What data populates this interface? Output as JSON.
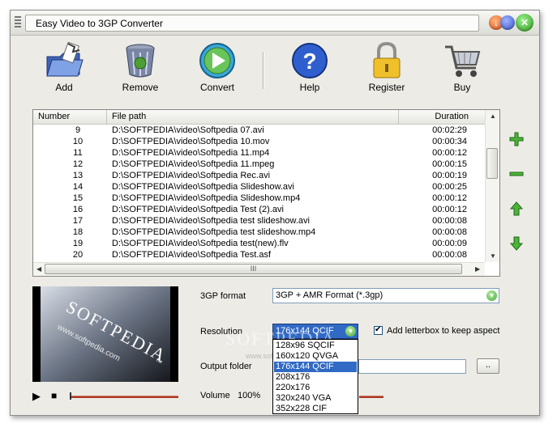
{
  "window": {
    "title": "Easy Video to 3GP Converter"
  },
  "toolbar": {
    "add": "Add",
    "remove": "Remove",
    "convert": "Convert",
    "help": "Help",
    "register": "Register",
    "buy": "Buy"
  },
  "filelist": {
    "headers": {
      "number": "Number",
      "path": "File path",
      "duration": "Duration"
    },
    "rows": [
      {
        "num": "9",
        "path": "D:\\SOFTPEDIA\\video\\Softpedia 07.avi",
        "dur": "00:02:29"
      },
      {
        "num": "10",
        "path": "D:\\SOFTPEDIA\\video\\Softpedia 10.mov",
        "dur": "00:00:34"
      },
      {
        "num": "11",
        "path": "D:\\SOFTPEDIA\\video\\Softpedia 11.mp4",
        "dur": "00:00:12"
      },
      {
        "num": "12",
        "path": "D:\\SOFTPEDIA\\video\\Softpedia 11.mpeg",
        "dur": "00:00:15"
      },
      {
        "num": "13",
        "path": "D:\\SOFTPEDIA\\video\\Softpedia Rec.avi",
        "dur": "00:00:19"
      },
      {
        "num": "14",
        "path": "D:\\SOFTPEDIA\\video\\Softpedia Slideshow.avi",
        "dur": "00:00:25"
      },
      {
        "num": "15",
        "path": "D:\\SOFTPEDIA\\video\\Softpedia Slideshow.mp4",
        "dur": "00:00:12"
      },
      {
        "num": "16",
        "path": "D:\\SOFTPEDIA\\video\\Softpedia Test (2).avi",
        "dur": "00:00:12"
      },
      {
        "num": "17",
        "path": "D:\\SOFTPEDIA\\video\\Softpedia test slideshow.avi",
        "dur": "00:00:08"
      },
      {
        "num": "18",
        "path": "D:\\SOFTPEDIA\\video\\Softpedia test slideshow.mp4",
        "dur": "00:00:08"
      },
      {
        "num": "19",
        "path": "D:\\SOFTPEDIA\\video\\Softpedia test(new).flv",
        "dur": "00:00:09"
      },
      {
        "num": "20",
        "path": "D:\\SOFTPEDIA\\video\\Softpedia Test.asf",
        "dur": "00:00:08"
      }
    ],
    "hscroll_grip": "III"
  },
  "side_buttons": {
    "add": "+",
    "remove": "−",
    "up": "↑",
    "down": "↓"
  },
  "preview": {
    "text": "SOFTPEDIA",
    "tm": "™",
    "url": "www.softpedia.com"
  },
  "player": {
    "play": "▶",
    "stop": "■"
  },
  "settings": {
    "format_label": "3GP format",
    "format_value": "3GP + AMR Format (*.3gp)",
    "resolution_label": "Resolution",
    "resolution_value": "176x144 QCIF",
    "resolution_options": [
      "128x96 SQCIF",
      "160x120 QVGA",
      "176x144 QCIF",
      "208x176",
      "220x176",
      "320x240 VGA",
      "352x228 CIF"
    ],
    "selected_index": 2,
    "letterbox_label": "Add letterbox to keep aspect",
    "letterbox_checked": "✔",
    "output_label": "Output folder",
    "browse": "..",
    "volume_label": "Volume",
    "volume_value": "100%"
  },
  "watermark": {
    "text": "SOFTPEDIA",
    "url": "www.softpedia.com"
  },
  "colors": {
    "accent": "#316ac5",
    "green": "#2f9d22",
    "slider": "#a83a22"
  }
}
